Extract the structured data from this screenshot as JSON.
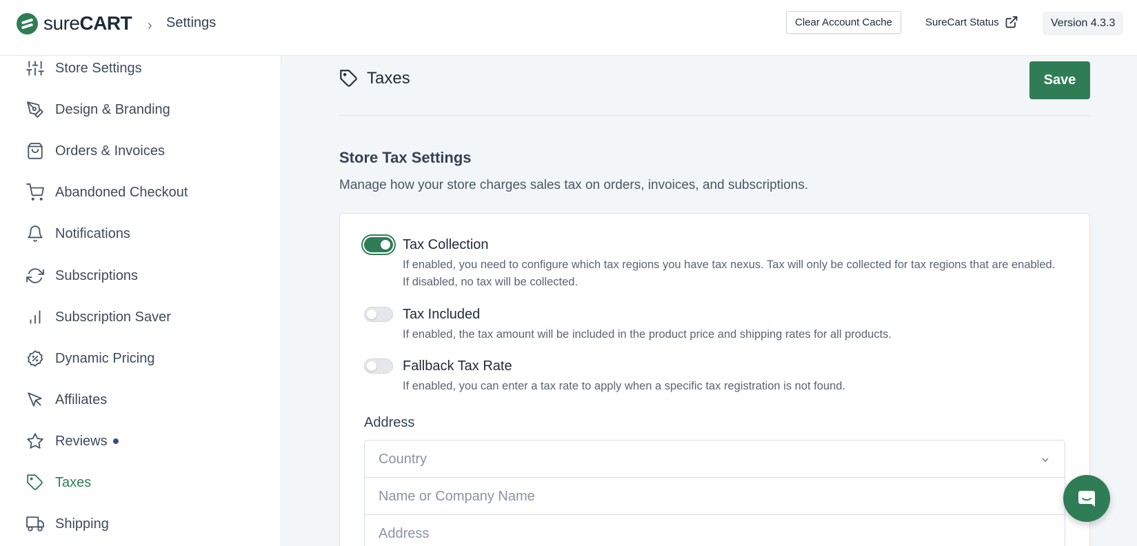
{
  "header": {
    "brand_first": "sure",
    "brand_second": "CART",
    "breadcrumb_separator": "›",
    "breadcrumb_current": "Settings",
    "clear_cache_label": "Clear Account Cache",
    "status_label": "SureCart Status",
    "version_label": "Version 4.3.3"
  },
  "sidebar": {
    "items": [
      {
        "label": "Store Settings",
        "icon": "sliders-icon"
      },
      {
        "label": "Design & Branding",
        "icon": "pen-tool-icon"
      },
      {
        "label": "Orders & Invoices",
        "icon": "shopping-bag-icon"
      },
      {
        "label": "Abandoned Checkout",
        "icon": "shopping-cart-icon"
      },
      {
        "label": "Notifications",
        "icon": "bell-icon"
      },
      {
        "label": "Subscriptions",
        "icon": "refresh-icon"
      },
      {
        "label": "Subscription Saver",
        "icon": "bar-chart-icon"
      },
      {
        "label": "Dynamic Pricing",
        "icon": "percent-badge-icon"
      },
      {
        "label": "Affiliates",
        "icon": "cursor-icon"
      },
      {
        "label": "Reviews",
        "icon": "star-icon"
      },
      {
        "label": "Taxes",
        "icon": "tag-icon",
        "active": true
      },
      {
        "label": "Shipping",
        "icon": "truck-icon"
      }
    ]
  },
  "main": {
    "title": "Taxes",
    "save_label": "Save",
    "section_title": "Store Tax Settings",
    "section_desc": "Manage how your store charges sales tax on orders, invoices, and subscriptions.",
    "settings": [
      {
        "title": "Tax Collection",
        "desc": "If enabled, you need to configure which tax regions you have tax nexus. Tax will only be collected for tax regions that are enabled. If disabled, no tax will be collected.",
        "enabled": true
      },
      {
        "title": "Tax Included",
        "desc": "If enabled, the tax amount will be included in the product price and shipping rates for all products.",
        "enabled": false
      },
      {
        "title": "Fallback Tax Rate",
        "desc": "If enabled, you can enter a tax rate to apply when a specific tax registration is not found.",
        "enabled": false
      }
    ],
    "address_label": "Address",
    "address_fields": {
      "country_placeholder": "Country",
      "name_placeholder": "Name or Company Name",
      "address_placeholder": "Address"
    }
  },
  "colors": {
    "accent": "#2f7d56",
    "review_dot": "#3b4a8c"
  }
}
